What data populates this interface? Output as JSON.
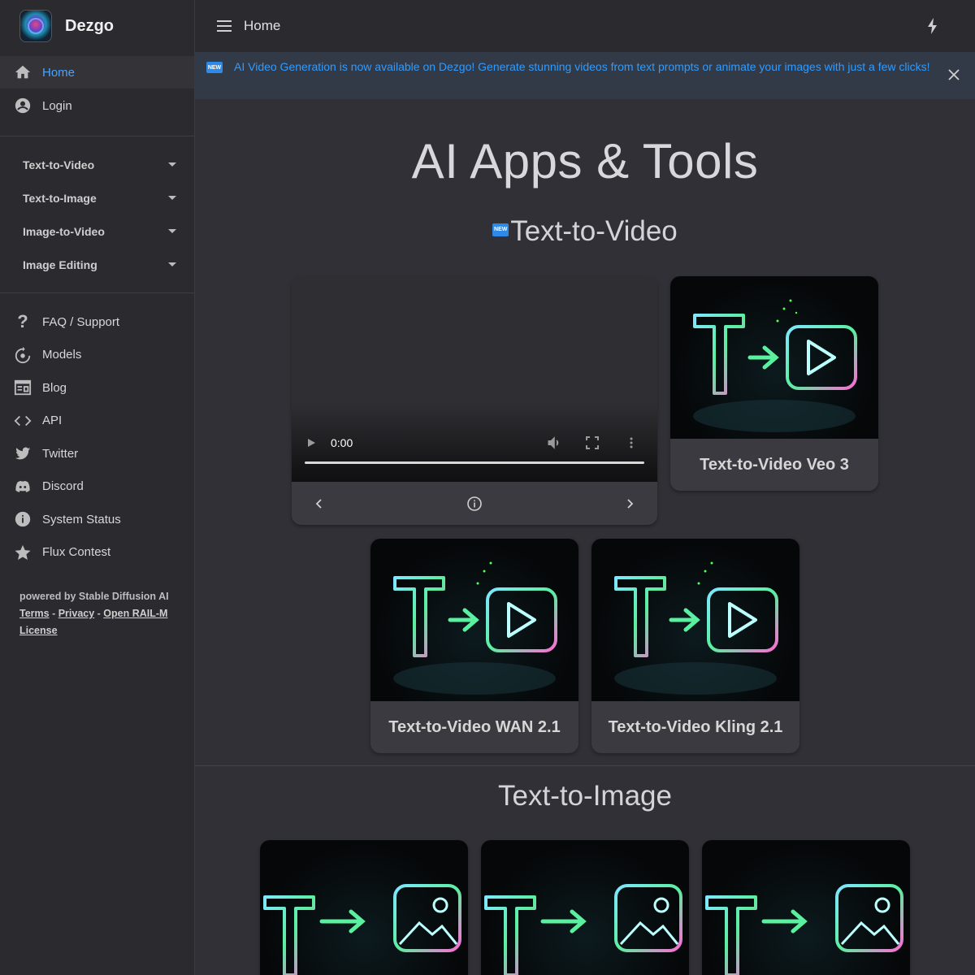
{
  "brand": {
    "name": "Dezgo"
  },
  "topbar": {
    "title": "Home"
  },
  "nav_primary": [
    {
      "label": "Home",
      "icon": "home-icon",
      "active": true
    },
    {
      "label": "Login",
      "icon": "account-circle-icon",
      "active": false
    }
  ],
  "categories": [
    {
      "label": "Text-to-Video"
    },
    {
      "label": "Text-to-Image"
    },
    {
      "label": "Image-to-Video"
    },
    {
      "label": "Image Editing"
    }
  ],
  "nav_secondary": [
    {
      "label": "FAQ / Support",
      "icon": "question-mark-icon"
    },
    {
      "label": "Models",
      "icon": "models-icon"
    },
    {
      "label": "Blog",
      "icon": "blog-icon"
    },
    {
      "label": "API",
      "icon": "code-icon"
    },
    {
      "label": "Twitter",
      "icon": "twitter-icon"
    },
    {
      "label": "Discord",
      "icon": "discord-icon"
    },
    {
      "label": "System Status",
      "icon": "info-icon"
    },
    {
      "label": "Flux Contest",
      "icon": "star-icon"
    }
  ],
  "footer": {
    "powered": "powered by Stable Diffusion AI",
    "terms": "Terms",
    "sep1": " - ",
    "privacy": "Privacy",
    "sep2": " - ",
    "license": "Open RAIL-M License"
  },
  "banner": {
    "badge": "NEW",
    "text": "AI Video Generation is now available on Dezgo! Generate stunning videos from text prompts or animate your images with just a few clicks!"
  },
  "main": {
    "title": "AI Apps & Tools",
    "section1": {
      "badge": "NEW",
      "title": "Text-to-Video"
    },
    "section2": {
      "title": "Text-to-Image"
    },
    "video": {
      "time": "0:00"
    },
    "video_cards": [
      {
        "label": "Text-to-Video Veo 3"
      },
      {
        "label": "Text-to-Video WAN 2.1"
      },
      {
        "label": "Text-to-Video Kling 2.1"
      }
    ]
  },
  "colors": {
    "accent": "#2f9bff",
    "sidebar_bg": "#2a2a2f",
    "main_bg": "#303036",
    "banner_bg": "#333a47"
  }
}
